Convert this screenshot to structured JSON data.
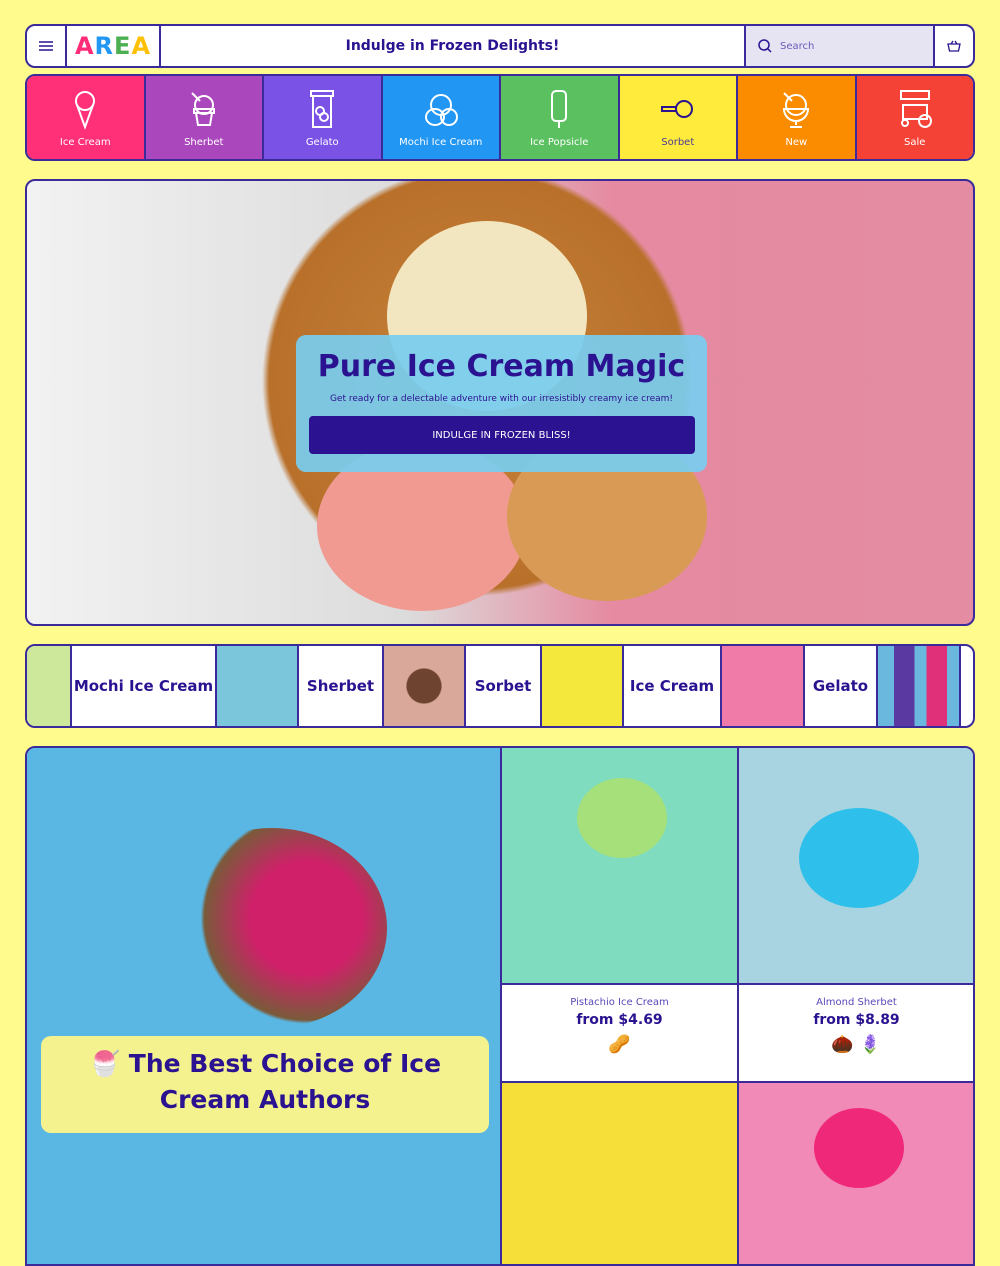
{
  "header": {
    "logo": "AREA",
    "logo_colors": [
      "#ff2d78",
      "#2196f3",
      "#4caf50",
      "#ffc107"
    ],
    "title": "Indulge in Frozen Delights!",
    "search_placeholder": "Search"
  },
  "categories": [
    {
      "label": "Ice Cream",
      "color": "#ff2f78",
      "icon": "ice-cream-cone"
    },
    {
      "label": "Sherbet",
      "color": "#ab47bc",
      "icon": "sherbet-cup"
    },
    {
      "label": "Gelato",
      "color": "#7b52e6",
      "icon": "gelato-tub"
    },
    {
      "label": "Mochi Ice Cream",
      "color": "#2196f3",
      "icon": "mochi"
    },
    {
      "label": "Ice Popsicle",
      "color": "#5ac060",
      "icon": "popsicle"
    },
    {
      "label": "Sorbet",
      "color": "#ffeb3b",
      "icon": "scoop"
    },
    {
      "label": "New",
      "color": "#fb8c00",
      "icon": "sundae"
    },
    {
      "label": "Sale",
      "color": "#f44336",
      "icon": "cart-stand"
    }
  ],
  "hero": {
    "title": "Pure Ice Cream Magic",
    "subtitle": "Get ready for a delectable adventure with our irresistibly creamy ice cream!",
    "cta": "INDULGE IN FROZEN BLISS!"
  },
  "strip": [
    "Mochi Ice Cream",
    "Sherbet",
    "Sorbet",
    "Ice Cream",
    "Gelato"
  ],
  "feature": {
    "caption": "The Best Choice of Ice Cream Authors"
  },
  "products": [
    {
      "name": "Pistachio Ice Cream",
      "price": "from $4.69",
      "icons": "🥜"
    },
    {
      "name": "Almond Sherbet",
      "price": "from $8.89",
      "icons": "🌰 🪻"
    }
  ]
}
